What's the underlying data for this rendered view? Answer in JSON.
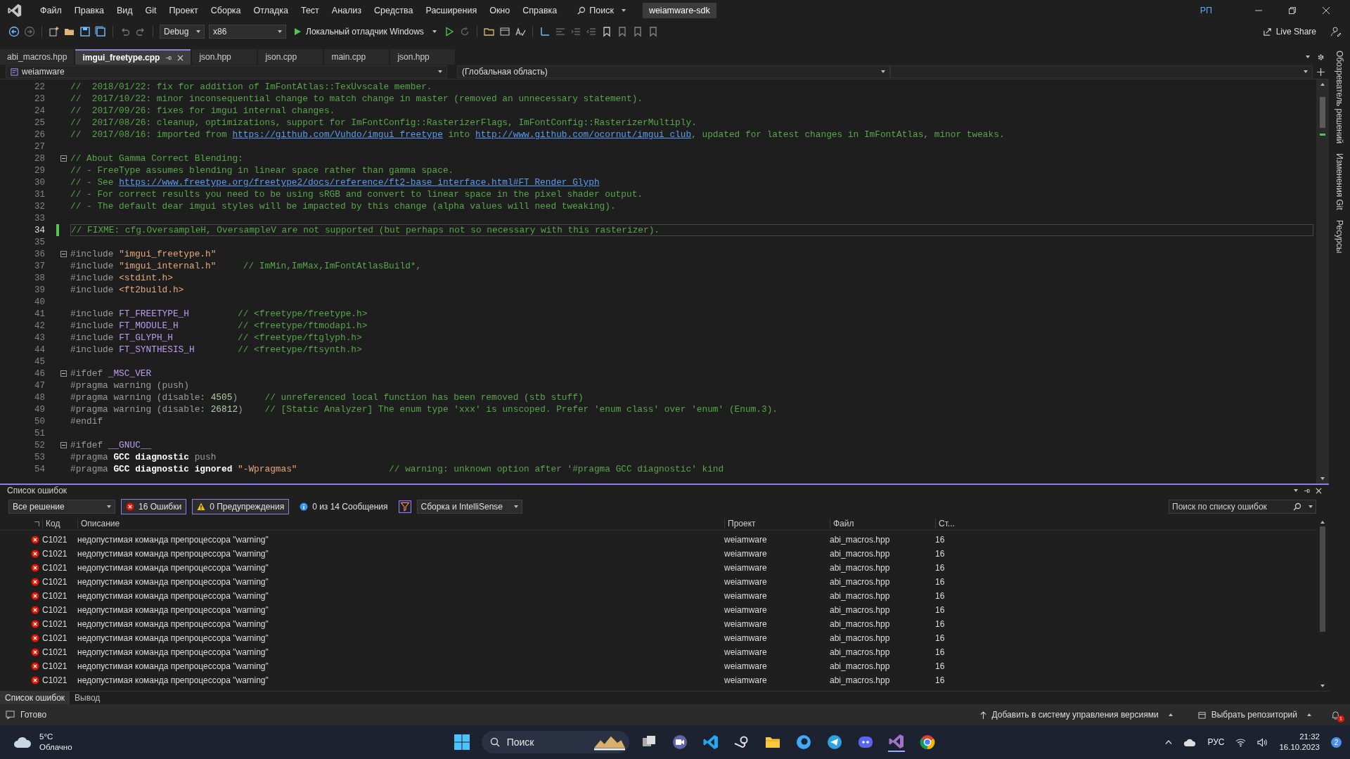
{
  "menu_bar": {
    "items": [
      "Файл",
      "Правка",
      "Вид",
      "Git",
      "Проект",
      "Сборка",
      "Отладка",
      "Тест",
      "Анализ",
      "Средства",
      "Расширения",
      "Окно",
      "Справка"
    ],
    "search": "Поиск",
    "solution": "weiamware-sdk",
    "user_initials": "РП"
  },
  "toolbar": {
    "configuration": "Debug",
    "platform": "x86",
    "debugger": "Локальный отладчик Windows",
    "live_share": "Live Share"
  },
  "tabs": [
    {
      "label": "abi_macros.hpp",
      "selected": false
    },
    {
      "label": "imgui_freetype.cpp",
      "selected": true
    },
    {
      "label": "json.hpp",
      "selected": false
    },
    {
      "label": "json.cpp",
      "selected": false
    },
    {
      "label": "main.cpp",
      "selected": false
    },
    {
      "label": "json.hpp",
      "selected": false
    }
  ],
  "nav_bar": {
    "project": "weiamware",
    "scope": "(Глобальная область)"
  },
  "editor": {
    "lines": [
      {
        "number": "22",
        "current": false,
        "fold": false,
        "tokens": [
          {
            "kind": "comment",
            "text": "//  2018/01/22: fix for addition of ImFontAtlas::TexUvscale member."
          }
        ]
      },
      {
        "number": "23",
        "current": false,
        "fold": false,
        "tokens": [
          {
            "kind": "comment",
            "text": "//  2017/10/22: minor inconsequential change to match change in master (removed an unnecessary statement)."
          }
        ]
      },
      {
        "number": "24",
        "current": false,
        "fold": false,
        "tokens": [
          {
            "kind": "comment",
            "text": "//  2017/09/26: fixes for imgui internal changes."
          }
        ]
      },
      {
        "number": "25",
        "current": false,
        "fold": false,
        "tokens": [
          {
            "kind": "comment",
            "text": "//  2017/08/26: cleanup, optimizations, support for ImFontConfig::RasterizerFlags, ImFontConfig::RasterizerMultiply."
          }
        ]
      },
      {
        "number": "26",
        "current": false,
        "fold": false,
        "tokens": [
          {
            "kind": "comment",
            "text": "//  2017/08/16: imported from "
          },
          {
            "kind": "link",
            "text": "https://github.com/Vuhdo/imgui_freetype"
          },
          {
            "kind": "comment",
            "text": " into "
          },
          {
            "kind": "link",
            "text": "http://www.github.com/ocornut/imgui_club"
          },
          {
            "kind": "comment",
            "text": ", updated for latest changes in ImFontAtlas, minor tweaks."
          }
        ]
      },
      {
        "number": "27",
        "current": false,
        "fold": false
      },
      {
        "number": "28",
        "current": false,
        "fold": true,
        "tokens": [
          {
            "kind": "comment",
            "text": "// About Gamma Correct Blending:"
          }
        ]
      },
      {
        "number": "29",
        "current": false,
        "fold": false,
        "tokens": [
          {
            "kind": "comment",
            "text": "// - FreeType assumes blending in linear space rather than gamma space."
          }
        ]
      },
      {
        "number": "30",
        "current": false,
        "fold": false,
        "tokens": [
          {
            "kind": "comment",
            "text": "// - See "
          },
          {
            "kind": "link",
            "text": "https://www.freetype.org/freetype2/docs/reference/ft2-base_interface.html#FT_Render_Glyph"
          }
        ]
      },
      {
        "number": "31",
        "current": false,
        "fold": false,
        "tokens": [
          {
            "kind": "comment",
            "text": "// - For correct results you need to be using sRGB and convert to linear space in the pixel shader output."
          }
        ]
      },
      {
        "number": "32",
        "current": false,
        "fold": false,
        "tokens": [
          {
            "kind": "comment",
            "text": "// - The default dear imgui styles will be impacted by this change (alpha values will need tweaking)."
          }
        ]
      },
      {
        "number": "33",
        "current": false,
        "fold": false
      },
      {
        "number": "34",
        "current": true,
        "fold": false,
        "tokens": [
          {
            "kind": "comment",
            "text": "// FIXME: cfg.OversampleH, OversampleV are not supported (but perhaps not so necessary with this rasterizer)."
          }
        ]
      },
      {
        "number": "35",
        "current": false,
        "fold": false
      },
      {
        "number": "36",
        "current": false,
        "fold": true,
        "tokens": [
          {
            "kind": "pp",
            "text": "#include "
          },
          {
            "kind": "string",
            "text": "\"imgui_freetype.h\""
          }
        ]
      },
      {
        "number": "37",
        "current": false,
        "fold": false,
        "tokens": [
          {
            "kind": "pp",
            "text": "#include "
          },
          {
            "kind": "string",
            "text": "\"imgui_internal.h\""
          },
          {
            "kind": "comment",
            "text": "     // ImMin,ImMax,ImFontAtlasBuild*,"
          }
        ]
      },
      {
        "number": "38",
        "current": false,
        "fold": false,
        "tokens": [
          {
            "kind": "pp",
            "text": "#include "
          },
          {
            "kind": "string",
            "text": "<stdint.h>"
          }
        ]
      },
      {
        "number": "39",
        "current": false,
        "fold": false,
        "tokens": [
          {
            "kind": "pp",
            "text": "#include "
          },
          {
            "kind": "string",
            "text": "<ft2build.h>"
          }
        ]
      },
      {
        "number": "40",
        "current": false,
        "fold": false
      },
      {
        "number": "41",
        "current": false,
        "fold": false,
        "tokens": [
          {
            "kind": "pp",
            "text": "#include "
          },
          {
            "kind": "macro",
            "text": "FT_FREETYPE_H"
          },
          {
            "kind": "comment",
            "text": "         // <freetype/freetype.h>"
          }
        ]
      },
      {
        "number": "42",
        "current": false,
        "fold": false,
        "tokens": [
          {
            "kind": "pp",
            "text": "#include "
          },
          {
            "kind": "macro",
            "text": "FT_MODULE_H"
          },
          {
            "kind": "comment",
            "text": "           // <freetype/ftmodapi.h>"
          }
        ]
      },
      {
        "number": "43",
        "current": false,
        "fold": false,
        "tokens": [
          {
            "kind": "pp",
            "text": "#include "
          },
          {
            "kind": "macro",
            "text": "FT_GLYPH_H"
          },
          {
            "kind": "comment",
            "text": "            // <freetype/ftglyph.h>"
          }
        ]
      },
      {
        "number": "44",
        "current": false,
        "fold": false,
        "tokens": [
          {
            "kind": "pp",
            "text": "#include "
          },
          {
            "kind": "macro",
            "text": "FT_SYNTHESIS_H"
          },
          {
            "kind": "comment",
            "text": "        // <freetype/ftsynth.h>"
          }
        ]
      },
      {
        "number": "45",
        "current": false,
        "fold": false
      },
      {
        "number": "46",
        "current": false,
        "fold": true,
        "tokens": [
          {
            "kind": "pp",
            "text": "#ifdef "
          },
          {
            "kind": "macro",
            "text": "_MSC_VER"
          }
        ]
      },
      {
        "number": "47",
        "current": false,
        "fold": false,
        "tokens": [
          {
            "kind": "pp",
            "text": "#pragma warning (push)"
          }
        ]
      },
      {
        "number": "48",
        "current": false,
        "fold": false,
        "tokens": [
          {
            "kind": "pp",
            "text": "#pragma warning (disable: "
          },
          {
            "kind": "number",
            "text": "4505"
          },
          {
            "kind": "pp",
            "text": ")"
          },
          {
            "kind": "comment",
            "text": "     // unreferenced local function has been removed (stb stuff)"
          }
        ]
      },
      {
        "number": "49",
        "current": false,
        "fold": false,
        "tokens": [
          {
            "kind": "pp",
            "text": "#pragma warning (disable: "
          },
          {
            "kind": "number",
            "text": "26812"
          },
          {
            "kind": "pp",
            "text": ")"
          },
          {
            "kind": "comment",
            "text": "    // [Static Analyzer] The enum type 'xxx' is unscoped. Prefer 'enum class' over 'enum' (Enum.3)."
          }
        ]
      },
      {
        "number": "50",
        "current": false,
        "fold": false,
        "tokens": [
          {
            "kind": "pp",
            "text": "#endif"
          }
        ]
      },
      {
        "number": "51",
        "current": false,
        "fold": false
      },
      {
        "number": "52",
        "current": false,
        "fold": true,
        "tokens": [
          {
            "kind": "pp",
            "text": "#ifdef "
          },
          {
            "kind": "macro",
            "text": "__GNUC__"
          }
        ]
      },
      {
        "number": "53",
        "current": false,
        "fold": false,
        "tokens": [
          {
            "kind": "pp",
            "text": "#pragma "
          },
          {
            "kind": "bold",
            "text": "GCC diagnostic"
          },
          {
            "kind": "pp",
            "text": " push"
          }
        ]
      },
      {
        "number": "54",
        "current": false,
        "fold": false,
        "tokens": [
          {
            "kind": "pp",
            "text": "#pragma "
          },
          {
            "kind": "bold",
            "text": "GCC diagnostic ignored"
          },
          {
            "kind": "string",
            "text": " \"-Wpragmas\""
          },
          {
            "kind": "comment",
            "text": "                 // warning: unknown option after '#pragma GCC diagnostic' kind"
          }
        ]
      }
    ]
  },
  "side_tabs": [
    "Обозреватель решений",
    "Изменения Git",
    "Ресурсы"
  ],
  "error_list": {
    "title": "Список ошибок",
    "scope": "Все решение",
    "filters": [
      {
        "kind": "error",
        "label": "16 Ошибки",
        "selected": true
      },
      {
        "kind": "warning",
        "label": "0 Предупреждения",
        "selected": true
      },
      {
        "kind": "info",
        "label": "0 из 14 Сообщения",
        "selected": false
      }
    ],
    "source": "Сборка и IntelliSense",
    "search_placeholder": "Поиск по списку ошибок",
    "columns": [
      "Код",
      "Описание",
      "Проект",
      "Файл",
      "Ст..."
    ],
    "rows": [
      {
        "code": "C1021",
        "description": "недопустимая команда препроцессора \"warning\"",
        "project": "weiamware",
        "file": "abi_macros.hpp",
        "line": "16"
      },
      {
        "code": "C1021",
        "description": "недопустимая команда препроцессора \"warning\"",
        "project": "weiamware",
        "file": "abi_macros.hpp",
        "line": "16"
      },
      {
        "code": "C1021",
        "description": "недопустимая команда препроцессора \"warning\"",
        "project": "weiamware",
        "file": "abi_macros.hpp",
        "line": "16"
      },
      {
        "code": "C1021",
        "description": "недопустимая команда препроцессора \"warning\"",
        "project": "weiamware",
        "file": "abi_macros.hpp",
        "line": "16"
      },
      {
        "code": "C1021",
        "description": "недопустимая команда препроцессора \"warning\"",
        "project": "weiamware",
        "file": "abi_macros.hpp",
        "line": "16"
      },
      {
        "code": "C1021",
        "description": "недопустимая команда препроцессора \"warning\"",
        "project": "weiamware",
        "file": "abi_macros.hpp",
        "line": "16"
      },
      {
        "code": "C1021",
        "description": "недопустимая команда препроцессора \"warning\"",
        "project": "weiamware",
        "file": "abi_macros.hpp",
        "line": "16"
      },
      {
        "code": "C1021",
        "description": "недопустимая команда препроцессора \"warning\"",
        "project": "weiamware",
        "file": "abi_macros.hpp",
        "line": "16"
      },
      {
        "code": "C1021",
        "description": "недопустимая команда препроцессора \"warning\"",
        "project": "weiamware",
        "file": "abi_macros.hpp",
        "line": "16"
      },
      {
        "code": "C1021",
        "description": "недопустимая команда препроцессора \"warning\"",
        "project": "weiamware",
        "file": "abi_macros.hpp",
        "line": "16"
      },
      {
        "code": "C1021",
        "description": "недопустимая команда препроцессора \"warning\"",
        "project": "weiamware",
        "file": "abi_macros.hpp",
        "line": "16"
      }
    ]
  },
  "bottom_tabs": [
    {
      "label": "Список ошибок",
      "selected": true
    },
    {
      "label": "Вывод",
      "selected": false
    }
  ],
  "status_bar": {
    "status": "Готово",
    "add_to_source_control": "Добавить в систему управления версиями",
    "select_repository": "Выбрать репозиторий",
    "notifications": "1"
  },
  "taskbar": {
    "temperature": "5°C",
    "weather": "Облачно",
    "search_placeholder": "Поиск",
    "language": "РУС",
    "time": "21:32",
    "date": "16.10.2023",
    "badge": "2"
  }
}
